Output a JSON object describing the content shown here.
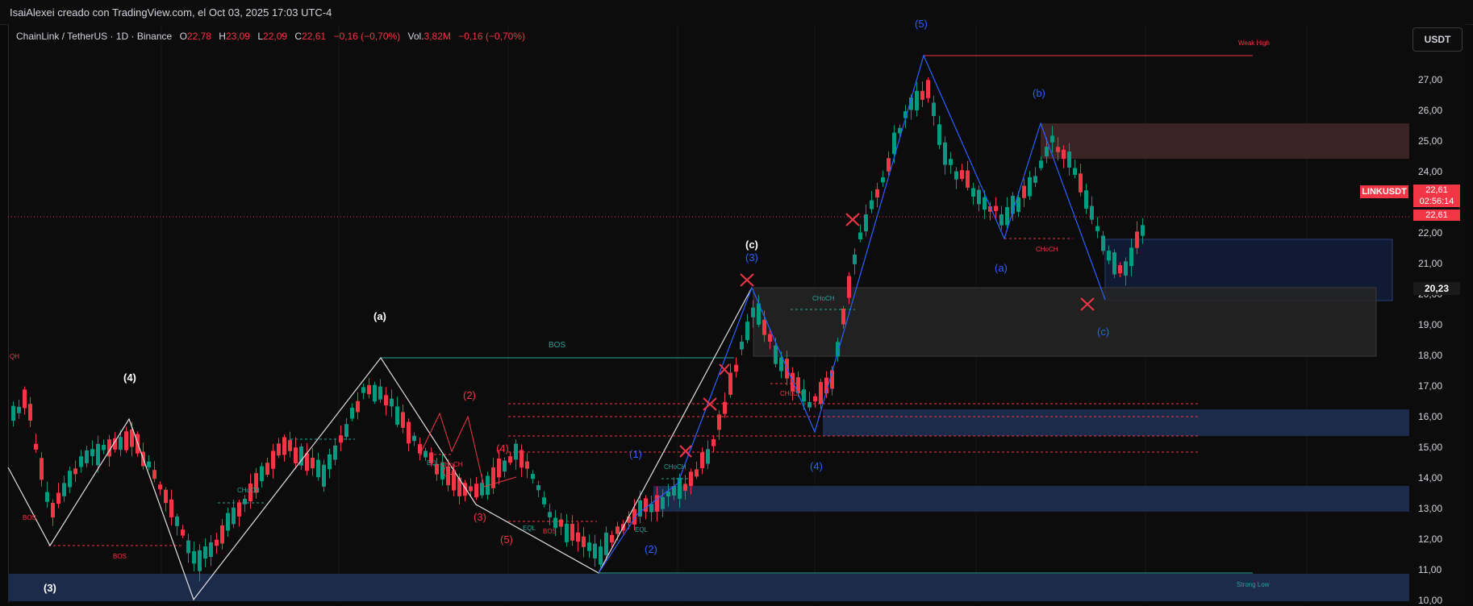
{
  "header": {
    "attribution": "IsaiAlexei creado con TradingView.com, el Oct 03, 2025 17:03 UTC-4"
  },
  "legend": {
    "symbol": "ChainLink / TetherUS · 1D · Binance",
    "o_label": "O",
    "o_value": "22,78",
    "h_label": "H",
    "h_value": "23,09",
    "l_label": "L",
    "l_value": "22,09",
    "c_label": "C",
    "c_value": "22,61",
    "change": "−0,16 (−0,70%)",
    "vol_label": "Vol.",
    "vol_value": "3,82M",
    "vol_change": "−0,16 (−0,70%)"
  },
  "toolbar": {
    "currency_button": "USDT"
  },
  "price_axis": {
    "ticks": [
      "27,00",
      "26,00",
      "25,00",
      "24,00",
      "22,00",
      "21,00",
      "20,00",
      "19,00",
      "18,00",
      "17,00",
      "16,00",
      "15,00",
      "14,00",
      "13,00",
      "12,00",
      "11,00",
      "10,00"
    ]
  },
  "price_tags": {
    "symbol": "LINKUSDT",
    "last_price": "22,61",
    "countdown": "02:56:14",
    "last_price_repeat": "22,61",
    "level": "20,23"
  },
  "annotations": {
    "wave_labels_white": [
      "(3)",
      "(4)",
      "(a)",
      "(c)"
    ],
    "wave_labels_red": [
      "(1)",
      "(2)",
      "(3)",
      "(4)",
      "(5)"
    ],
    "wave_labels_blue": [
      "(1)",
      "(2)",
      "(3)",
      "(4)",
      "(5)",
      "(a)",
      "(b)",
      "(c)"
    ],
    "structure": [
      "BOS",
      "BOS",
      "BOS",
      "CHoCH",
      "CHoCH",
      "CHoCH",
      "CHoCH",
      "CHoCH",
      "CHoCH",
      "EQL",
      "EQL",
      "EQL",
      "QH",
      "BOS"
    ],
    "weak_high": "Weak High",
    "strong_low": "Strong Low"
  },
  "colors": {
    "background": "#0a0a0a",
    "up_candle": "#089981",
    "down_candle": "#f23645",
    "wave_blue": "#2962ff",
    "bos_teal": "#26a69a",
    "zone_blue": "#1e3a6b",
    "zone_red": "#5c2a2a"
  }
}
